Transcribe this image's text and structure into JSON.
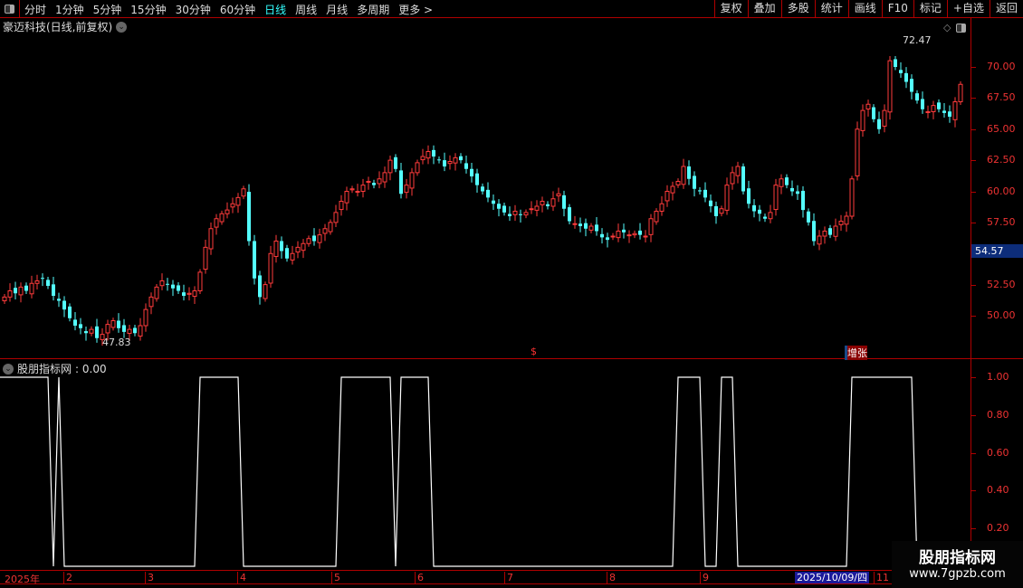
{
  "toolbar": {
    "periods": [
      "分时",
      "1分钟",
      "5分钟",
      "15分钟",
      "30分钟",
      "60分钟",
      "日线",
      "周线",
      "月线",
      "多周期",
      "更多 >"
    ],
    "active_period": "日线",
    "tools": [
      "复权",
      "叠加",
      "多股",
      "统计",
      "画线",
      "F10",
      "标记",
      "+自选",
      "返回"
    ]
  },
  "stock_title": "豪迈科技(日线,前复权)",
  "price_axis": {
    "labels": [
      "70.00",
      "67.50",
      "65.00",
      "62.50",
      "60.00",
      "57.50",
      "52.50",
      "50.00"
    ],
    "current_price": "54.57",
    "high_label": "72.47",
    "low_label": "47.83"
  },
  "markers": {
    "dollar": "$",
    "finance": "增张"
  },
  "indicator": {
    "title": "股朋指标网",
    "value": ": 0.00",
    "axis_labels": [
      "1.00",
      "0.80",
      "0.60",
      "0.40",
      "0.20"
    ]
  },
  "date_axis": {
    "labels": [
      "2025年",
      "2",
      "3",
      "4",
      "5",
      "6",
      "7",
      "8",
      "9",
      "11"
    ],
    "highlight": "2025/10/09/四"
  },
  "watermark": {
    "name": "股朋指标网",
    "url": "www.7gpzb.com"
  },
  "colors": {
    "up": "#ff3b3b",
    "down": "#54ffff",
    "accent": "#b00000"
  },
  "chart_data": {
    "type": "candlestick",
    "ylim": [
      46.5,
      74.5
    ],
    "closes": [
      51.5,
      52.0,
      51.8,
      52.3,
      52.0,
      52.6,
      52.8,
      53.0,
      52.4,
      51.6,
      51.2,
      50.5,
      49.8,
      49.2,
      49.0,
      48.6,
      48.9,
      48.2,
      48.5,
      49.3,
      49.6,
      49.0,
      48.7,
      48.9,
      48.6,
      49.2,
      50.5,
      51.5,
      52.3,
      52.8,
      52.5,
      52.2,
      52.0,
      51.6,
      51.8,
      52.0,
      53.5,
      55.5,
      57.0,
      57.8,
      58.2,
      58.5,
      59.0,
      59.5,
      60.2,
      56.0,
      53.0,
      51.5,
      52.5,
      55.0,
      56.0,
      55.2,
      54.6,
      55.0,
      55.5,
      55.8,
      56.2,
      56.0,
      56.5,
      57.0,
      57.5,
      58.3,
      59.2,
      60.0,
      60.2,
      60.0,
      60.5,
      60.8,
      60.5,
      61.0,
      61.5,
      62.5,
      61.8,
      59.8,
      60.5,
      61.5,
      62.3,
      62.8,
      63.2,
      62.8,
      62.5,
      62.0,
      62.4,
      62.7,
      62.5,
      61.8,
      61.2,
      60.5,
      60.0,
      59.5,
      59.0,
      58.6,
      58.3,
      58.0,
      58.4,
      58.1,
      58.3,
      58.6,
      58.8,
      59.2,
      58.8,
      59.4,
      59.8,
      58.6,
      57.6,
      57.4,
      57.2,
      57.0,
      57.2,
      56.8,
      56.3,
      56.1,
      56.4,
      56.8,
      56.7,
      56.5,
      56.6,
      56.5,
      56.4,
      57.8,
      58.4,
      59.0,
      60.0,
      60.4,
      60.8,
      62.0,
      61.0,
      60.2,
      60.0,
      59.5,
      58.8,
      58.0,
      58.6,
      60.5,
      61.5,
      62.0,
      60.0,
      59.0,
      58.4,
      58.2,
      57.8,
      58.3,
      60.5,
      61.0,
      60.5,
      60.0,
      59.8,
      58.5,
      57.5,
      56.0,
      56.4,
      56.8,
      56.5,
      57.2,
      57.6,
      58.0,
      61.0,
      65.0,
      66.5,
      67.0,
      65.8,
      65.0,
      66.5,
      70.5,
      70.0,
      69.5,
      68.8,
      68.0,
      67.3,
      66.6,
      66.4,
      66.9,
      66.6,
      66.3,
      66.0,
      67.2,
      68.6
    ],
    "indicator_length": 170,
    "indicator_one_runs": [
      [
        0,
        8
      ],
      [
        10,
        10
      ],
      [
        36,
        43
      ],
      [
        62,
        71
      ],
      [
        73,
        78
      ],
      [
        124,
        128
      ],
      [
        132,
        134
      ],
      [
        156,
        167
      ]
    ],
    "indicator_ylim": [
      0,
      1
    ]
  }
}
